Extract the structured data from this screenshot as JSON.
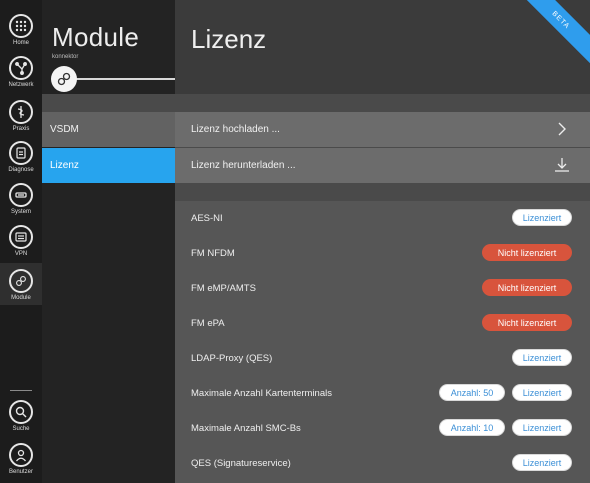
{
  "rail": {
    "items": [
      {
        "label": "Home",
        "icon": "grid-icon"
      },
      {
        "label": "Netzwerk",
        "icon": "network-icon"
      },
      {
        "label": "Praxis",
        "icon": "caduceus-icon"
      },
      {
        "label": "Diagnose",
        "icon": "clipboard-icon"
      },
      {
        "label": "System",
        "icon": "system-icon"
      },
      {
        "label": "VPN",
        "icon": "vpn-icon"
      },
      {
        "label": "Module",
        "icon": "modules-icon"
      },
      {
        "label": "Suche",
        "icon": "search-icon"
      },
      {
        "label": "Benutzer",
        "icon": "user-icon"
      }
    ]
  },
  "module_panel": {
    "title": "Module",
    "subtitle": "konnektor",
    "items": [
      {
        "label": "VSDM"
      },
      {
        "label": "Lizenz"
      }
    ]
  },
  "main": {
    "title": "Lizenz",
    "ribbon": "BETA",
    "actions": [
      {
        "label": "Lizenz hochladen ...",
        "icon": "chevron-right-icon"
      },
      {
        "label": "Lizenz herunterladen ...",
        "icon": "download-icon"
      }
    ],
    "licenses": [
      {
        "name": "AES-NI",
        "status": "Lizenziert",
        "count": ""
      },
      {
        "name": "FM NFDM",
        "status": "Nicht lizenziert",
        "count": ""
      },
      {
        "name": "FM eMP/AMTS",
        "status": "Nicht lizenziert",
        "count": ""
      },
      {
        "name": "FM ePA",
        "status": "Nicht lizenziert",
        "count": ""
      },
      {
        "name": "LDAP-Proxy (QES)",
        "status": "Lizenziert",
        "count": ""
      },
      {
        "name": "Maximale Anzahl Kartenterminals",
        "status": "Lizenziert",
        "count": "Anzahl: 50"
      },
      {
        "name": "Maximale Anzahl SMC-Bs",
        "status": "Lizenziert",
        "count": "Anzahl: 10"
      },
      {
        "name": "QES (Signatureservice)",
        "status": "Lizenziert",
        "count": ""
      }
    ]
  },
  "colors": {
    "accent": "#27a4ee",
    "licensed_text": "#3b8fd6",
    "not_licensed_bg": "#d8543c"
  }
}
